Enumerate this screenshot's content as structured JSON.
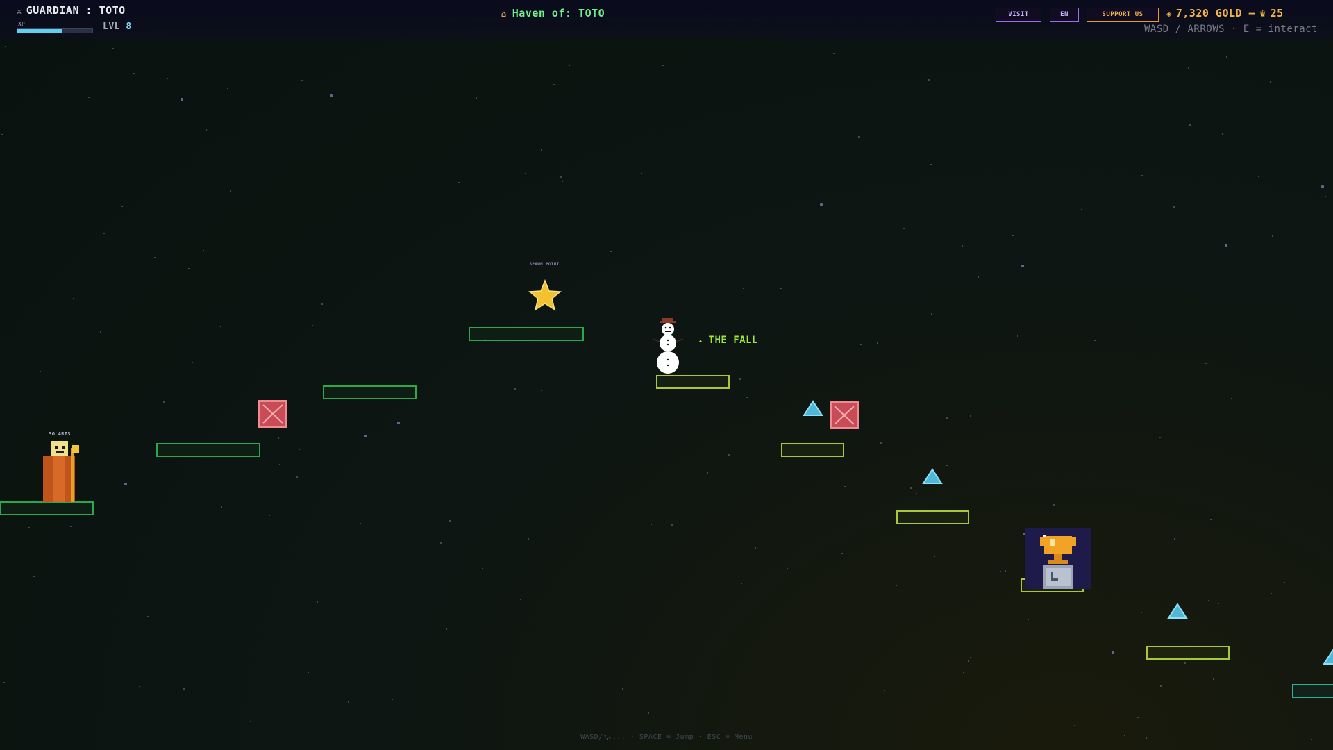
{
  "hud": {
    "guardian_title": "GUARDIAN : TOTO",
    "xp_label": "XP",
    "xp_progress": 0.6,
    "level_prefix": "LVL",
    "level_value": "8",
    "haven_title": "Haven of: TOTO",
    "visit_label": "VISIT",
    "lang_label": "EN",
    "support_label": "SUPPORT US",
    "gold_text": "7,320 GOLD –",
    "gems_value": "25",
    "controls_hint": "WASD / ARROWS · E = interact"
  },
  "world": {
    "spawn_label": "SPAWN POINT",
    "npc_name": "SOLARIS",
    "zone_label": "THE FALL",
    "bottom_hint": "WASD/↑↓... · SPACE = Jump · ESC = Menu"
  },
  "colors": {
    "platform_green": "#2aa84a",
    "platform_lime": "#a8c83a",
    "platform_teal": "#2ab0a0",
    "hazard_red": "#c94b55",
    "spike_cyan": "#4fb8d8",
    "gold": "#f2b44a",
    "haven_green": "#6ff08a",
    "accent_purple": "#9e6cf0"
  },
  "icons": {
    "guardian": "sword-icon",
    "haven": "house-icon",
    "gold": "coin-icon",
    "gems": "crown-icon",
    "spawn": "star-icon",
    "zone": "sparkle-icon",
    "hazard": "x-crate-icon",
    "spike": "spike-icon",
    "trophy": "trophy-icon"
  }
}
